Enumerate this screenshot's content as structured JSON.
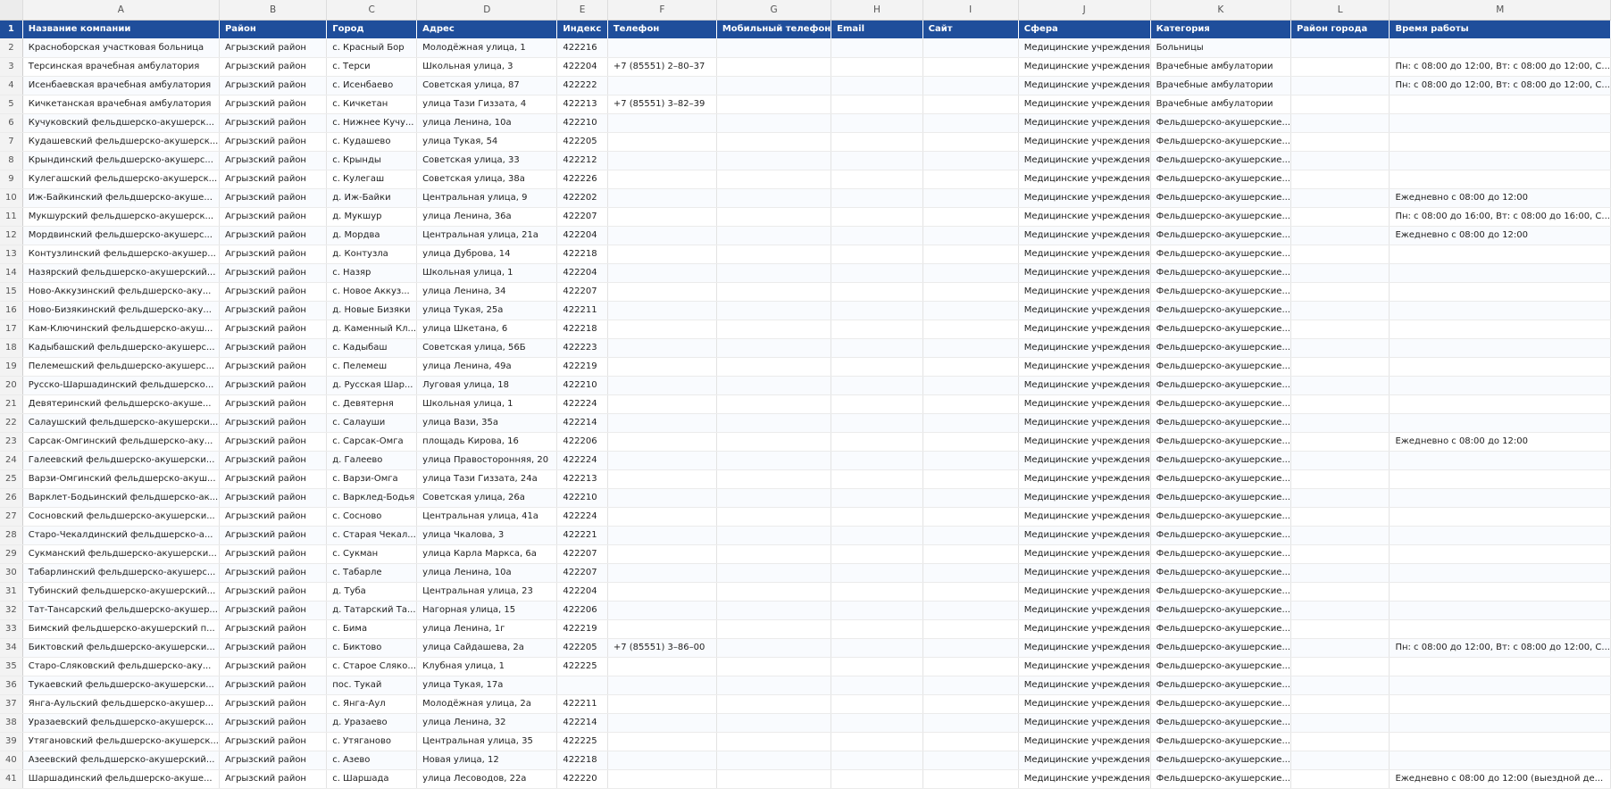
{
  "columns": [
    "A",
    "B",
    "C",
    "D",
    "E",
    "F",
    "G",
    "H",
    "I",
    "J",
    "K",
    "L",
    "M"
  ],
  "header_row_number": "1",
  "headers": [
    "Название компании",
    "Район",
    "Город",
    "Адрес",
    "Индекс",
    "Телефон",
    "Мобильный телефон",
    "Email",
    "Сайт",
    "Сфера",
    "Категория",
    "Район города",
    "Время работы"
  ],
  "rows": [
    {
      "n": "2",
      "cells": [
        "Красноборская участковая больница",
        "Агрызский район",
        "с. Красный Бор",
        "Молодёжная улица, 1",
        "422216",
        "",
        "",
        "",
        "",
        "Медицинские учреждения",
        "Больницы",
        "",
        ""
      ]
    },
    {
      "n": "3",
      "cells": [
        "Терсинская врачебная амбулатория",
        "Агрызский район",
        "с. Терси",
        "Школьная улица, 3",
        "422204",
        "+7 (85551) 2–80–37",
        "",
        "",
        "",
        "Медицинские учреждения",
        "Врачебные амбулатории",
        "",
        "Пн: с 08:00 до 12:00, Вт: с 08:00 до 12:00, С..."
      ]
    },
    {
      "n": "4",
      "cells": [
        "Исенбаевская врачебная амбулатория",
        "Агрызский район",
        "с. Исенбаево",
        "Советская улица, 87",
        "422222",
        "",
        "",
        "",
        "",
        "Медицинские учреждения",
        "Врачебные амбулатории",
        "",
        "Пн: с 08:00 до 12:00, Вт: с 08:00 до 12:00, С..."
      ]
    },
    {
      "n": "5",
      "cells": [
        "Кичкетанская врачебная амбулатория",
        "Агрызский район",
        "с. Кичкетан",
        "улица Тази Гиззата, 4",
        "422213",
        "+7 (85551) 3–82–39",
        "",
        "",
        "",
        "Медицинские учреждения",
        "Врачебные амбулатории",
        "",
        ""
      ]
    },
    {
      "n": "6",
      "cells": [
        "Кучуковский фельдшерско-акушерск...",
        "Агрызский район",
        "с. Нижнее Кучу...",
        "улица Ленина, 10а",
        "422210",
        "",
        "",
        "",
        "",
        "Медицинские учреждения",
        "Фельдшерско-акушерские...",
        "",
        ""
      ]
    },
    {
      "n": "7",
      "cells": [
        "Кудашевский фельдшерско-акушерск...",
        "Агрызский район",
        "с. Кудашево",
        "улица Тукая, 54",
        "422205",
        "",
        "",
        "",
        "",
        "Медицинские учреждения",
        "Фельдшерско-акушерские...",
        "",
        ""
      ]
    },
    {
      "n": "8",
      "cells": [
        "Крындинский фельдшерско-акушерс...",
        "Агрызский район",
        "с. Крынды",
        "Советская улица, 33",
        "422212",
        "",
        "",
        "",
        "",
        "Медицинские учреждения",
        "Фельдшерско-акушерские...",
        "",
        ""
      ]
    },
    {
      "n": "9",
      "cells": [
        "Кулегашский фельдшерско-акушерск...",
        "Агрызский район",
        "с. Кулегаш",
        "Советская улица, 38а",
        "422226",
        "",
        "",
        "",
        "",
        "Медицинские учреждения",
        "Фельдшерско-акушерские...",
        "",
        ""
      ]
    },
    {
      "n": "10",
      "cells": [
        "Иж-Байкинский фельдшерско-акуше...",
        "Агрызский район",
        "д. Иж-Байки",
        "Центральная улица, 9",
        "422202",
        "",
        "",
        "",
        "",
        "Медицинские учреждения",
        "Фельдшерско-акушерские...",
        "",
        "Ежедневно с 08:00 до 12:00"
      ]
    },
    {
      "n": "11",
      "cells": [
        "Мукшурский фельдшерско-акушерск...",
        "Агрызский район",
        "д. Мукшур",
        "улица Ленина, 36а",
        "422207",
        "",
        "",
        "",
        "",
        "Медицинские учреждения",
        "Фельдшерско-акушерские...",
        "",
        "Пн: с 08:00 до 16:00, Вт: с 08:00 до 16:00, С..."
      ]
    },
    {
      "n": "12",
      "cells": [
        "Мордвинский фельдшерско-акушерс...",
        "Агрызский район",
        "д. Мордва",
        "Центральная улица, 21а",
        "422204",
        "",
        "",
        "",
        "",
        "Медицинские учреждения",
        "Фельдшерско-акушерские...",
        "",
        "Ежедневно с 08:00 до 12:00"
      ]
    },
    {
      "n": "13",
      "cells": [
        "Контузлинский фельдшерско-акушер...",
        "Агрызский район",
        "д. Контузла",
        "улица Дуброва, 14",
        "422218",
        "",
        "",
        "",
        "",
        "Медицинские учреждения",
        "Фельдшерско-акушерские...",
        "",
        ""
      ]
    },
    {
      "n": "14",
      "cells": [
        "Назярский фельдшерско-акушерский...",
        "Агрызский район",
        "с. Назяр",
        "Школьная улица, 1",
        "422204",
        "",
        "",
        "",
        "",
        "Медицинские учреждения",
        "Фельдшерско-акушерские...",
        "",
        ""
      ]
    },
    {
      "n": "15",
      "cells": [
        "Ново-Аккузинский фельдшерско-аку...",
        "Агрызский район",
        "с. Новое Аккуз...",
        "улица Ленина, 34",
        "422207",
        "",
        "",
        "",
        "",
        "Медицинские учреждения",
        "Фельдшерско-акушерские...",
        "",
        ""
      ]
    },
    {
      "n": "16",
      "cells": [
        "Ново-Бизякинский фельдшерско-аку...",
        "Агрызский район",
        "д. Новые Бизяки",
        "улица Тукая, 25а",
        "422211",
        "",
        "",
        "",
        "",
        "Медицинские учреждения",
        "Фельдшерско-акушерские...",
        "",
        ""
      ]
    },
    {
      "n": "17",
      "cells": [
        "Кам-Ключинский фельдшерско-акуш...",
        "Агрызский район",
        "д. Каменный Кл...",
        "улица Шкетана, 6",
        "422218",
        "",
        "",
        "",
        "",
        "Медицинские учреждения",
        "Фельдшерско-акушерские...",
        "",
        ""
      ]
    },
    {
      "n": "18",
      "cells": [
        "Кадыбашский фельдшерско-акушерс...",
        "Агрызский район",
        "с. Кадыбаш",
        "Советская улица, 56Б",
        "422223",
        "",
        "",
        "",
        "",
        "Медицинские учреждения",
        "Фельдшерско-акушерские...",
        "",
        ""
      ]
    },
    {
      "n": "19",
      "cells": [
        "Пелемешский фельдшерско-акушерс...",
        "Агрызский район",
        "с. Пелемеш",
        "улица Ленина, 49а",
        "422219",
        "",
        "",
        "",
        "",
        "Медицинские учреждения",
        "Фельдшерско-акушерские...",
        "",
        ""
      ]
    },
    {
      "n": "20",
      "cells": [
        "Русско-Шаршадинский фельдшерско...",
        "Агрызский район",
        "д. Русская Шар...",
        "Луговая улица, 18",
        "422210",
        "",
        "",
        "",
        "",
        "Медицинские учреждения",
        "Фельдшерско-акушерские...",
        "",
        ""
      ]
    },
    {
      "n": "21",
      "cells": [
        "Девятеринский фельдшерско-акуше...",
        "Агрызский район",
        "с. Девятерня",
        "Школьная улица, 1",
        "422224",
        "",
        "",
        "",
        "",
        "Медицинские учреждения",
        "Фельдшерско-акушерские...",
        "",
        ""
      ]
    },
    {
      "n": "22",
      "cells": [
        "Салаушский фельдшерско-акушерски...",
        "Агрызский район",
        "с. Салауши",
        "улица Вази, 35а",
        "422214",
        "",
        "",
        "",
        "",
        "Медицинские учреждения",
        "Фельдшерско-акушерские...",
        "",
        ""
      ]
    },
    {
      "n": "23",
      "cells": [
        "Сарсак-Омгинский фельдшерско-аку...",
        "Агрызский район",
        "с. Сарсак-Омга",
        "площадь Кирова, 16",
        "422206",
        "",
        "",
        "",
        "",
        "Медицинские учреждения",
        "Фельдшерско-акушерские...",
        "",
        "Ежедневно с 08:00 до 12:00"
      ]
    },
    {
      "n": "24",
      "cells": [
        "Галеевский фельдшерско-акушерски...",
        "Агрызский район",
        "д. Галеево",
        "улица Правосторонняя, 20",
        "422224",
        "",
        "",
        "",
        "",
        "Медицинские учреждения",
        "Фельдшерско-акушерские...",
        "",
        ""
      ]
    },
    {
      "n": "25",
      "cells": [
        "Варзи-Омгинский фельдшерско-акуш...",
        "Агрызский район",
        "с. Варзи-Омга",
        "улица Тази Гиззата, 24а",
        "422213",
        "",
        "",
        "",
        "",
        "Медицинские учреждения",
        "Фельдшерско-акушерские...",
        "",
        ""
      ]
    },
    {
      "n": "26",
      "cells": [
        "Варклет-Бодьинский фельдшерско-ак...",
        "Агрызский район",
        "с. Варклед-Бодья",
        "Советская улица, 26а",
        "422210",
        "",
        "",
        "",
        "",
        "Медицинские учреждения",
        "Фельдшерско-акушерские...",
        "",
        ""
      ]
    },
    {
      "n": "27",
      "cells": [
        "Сосновский фельдшерско-акушерски...",
        "Агрызский район",
        "с. Сосново",
        "Центральная улица, 41а",
        "422224",
        "",
        "",
        "",
        "",
        "Медицинские учреждения",
        "Фельдшерско-акушерские...",
        "",
        ""
      ]
    },
    {
      "n": "28",
      "cells": [
        "Старо-Чекалдинский фельдшерско-а...",
        "Агрызский район",
        "с. Старая Чекал...",
        "улица Чкалова, 3",
        "422221",
        "",
        "",
        "",
        "",
        "Медицинские учреждения",
        "Фельдшерско-акушерские...",
        "",
        ""
      ]
    },
    {
      "n": "29",
      "cells": [
        "Сукманский фельдшерско-акушерски...",
        "Агрызский район",
        "с. Сукман",
        "улица Карла Маркса, 6а",
        "422207",
        "",
        "",
        "",
        "",
        "Медицинские учреждения",
        "Фельдшерско-акушерские...",
        "",
        ""
      ]
    },
    {
      "n": "30",
      "cells": [
        "Табарлинский фельдшерско-акушерс...",
        "Агрызский район",
        "с. Табарле",
        "улица Ленина, 10а",
        "422207",
        "",
        "",
        "",
        "",
        "Медицинские учреждения",
        "Фельдшерско-акушерские...",
        "",
        ""
      ]
    },
    {
      "n": "31",
      "cells": [
        "Тубинский фельдшерско-акушерский...",
        "Агрызский район",
        "д. Туба",
        "Центральная улица, 23",
        "422204",
        "",
        "",
        "",
        "",
        "Медицинские учреждения",
        "Фельдшерско-акушерские...",
        "",
        ""
      ]
    },
    {
      "n": "32",
      "cells": [
        "Тат-Тансарский фельдшерско-акушер...",
        "Агрызский район",
        "д. Татарский Та...",
        "Нагорная улица, 15",
        "422206",
        "",
        "",
        "",
        "",
        "Медицинские учреждения",
        "Фельдшерско-акушерские...",
        "",
        ""
      ]
    },
    {
      "n": "33",
      "cells": [
        "Бимский фельдшерско-акушерский п...",
        "Агрызский район",
        "с. Бима",
        "улица Ленина, 1г",
        "422219",
        "",
        "",
        "",
        "",
        "Медицинские учреждения",
        "Фельдшерско-акушерские...",
        "",
        ""
      ]
    },
    {
      "n": "34",
      "cells": [
        "Биктовский фельдшерско-акушерски...",
        "Агрызский район",
        "с. Биктово",
        "улица Сайдашева, 2а",
        "422205",
        "+7 (85551) 3–86–00",
        "",
        "",
        "",
        "Медицинские учреждения",
        "Фельдшерско-акушерские...",
        "",
        "Пн: с 08:00 до 12:00, Вт: с 08:00 до 12:00, С..."
      ]
    },
    {
      "n": "35",
      "cells": [
        "Старо-Сляковский фельдшерско-аку...",
        "Агрызский район",
        "с. Старое Сляко...",
        "Клубная улица, 1",
        "422225",
        "",
        "",
        "",
        "",
        "Медицинские учреждения",
        "Фельдшерско-акушерские...",
        "",
        ""
      ]
    },
    {
      "n": "36",
      "cells": [
        "Тукаевский фельдшерско-акушерски...",
        "Агрызский район",
        "пос. Тукай",
        "улица Тукая, 17а",
        "",
        "",
        "",
        "",
        "",
        "Медицинские учреждения",
        "Фельдшерско-акушерские...",
        "",
        ""
      ]
    },
    {
      "n": "37",
      "cells": [
        "Янга-Аульский фельдшерско-акушер...",
        "Агрызский район",
        "с. Янга-Аул",
        "Молодёжная улица, 2а",
        "422211",
        "",
        "",
        "",
        "",
        "Медицинские учреждения",
        "Фельдшерско-акушерские...",
        "",
        ""
      ]
    },
    {
      "n": "38",
      "cells": [
        "Уразаевский фельдшерско-акушерск...",
        "Агрызский район",
        "д. Уразаево",
        "улица Ленина, 32",
        "422214",
        "",
        "",
        "",
        "",
        "Медицинские учреждения",
        "Фельдшерско-акушерские...",
        "",
        ""
      ]
    },
    {
      "n": "39",
      "cells": [
        "Утягановский фельдшерско-акушерск...",
        "Агрызский район",
        "с. Утяганово",
        "Центральная улица, 35",
        "422225",
        "",
        "",
        "",
        "",
        "Медицинские учреждения",
        "Фельдшерско-акушерские...",
        "",
        ""
      ]
    },
    {
      "n": "40",
      "cells": [
        "Азеевский фельдшерско-акушерский...",
        "Агрызский район",
        "с. Азево",
        "Новая улица, 12",
        "422218",
        "",
        "",
        "",
        "",
        "Медицинские учреждения",
        "Фельдшерско-акушерские...",
        "",
        ""
      ]
    },
    {
      "n": "41",
      "cells": [
        "Шаршадинский фельдшерско-акуше...",
        "Агрызский район",
        "с. Шаршада",
        "улица Лесоводов, 22а",
        "422220",
        "",
        "",
        "",
        "",
        "Медицинские учреждения",
        "Фельдшерско-акушерские...",
        "",
        "Ежедневно с 08:00 до 12:00 (выездной де..."
      ]
    }
  ]
}
